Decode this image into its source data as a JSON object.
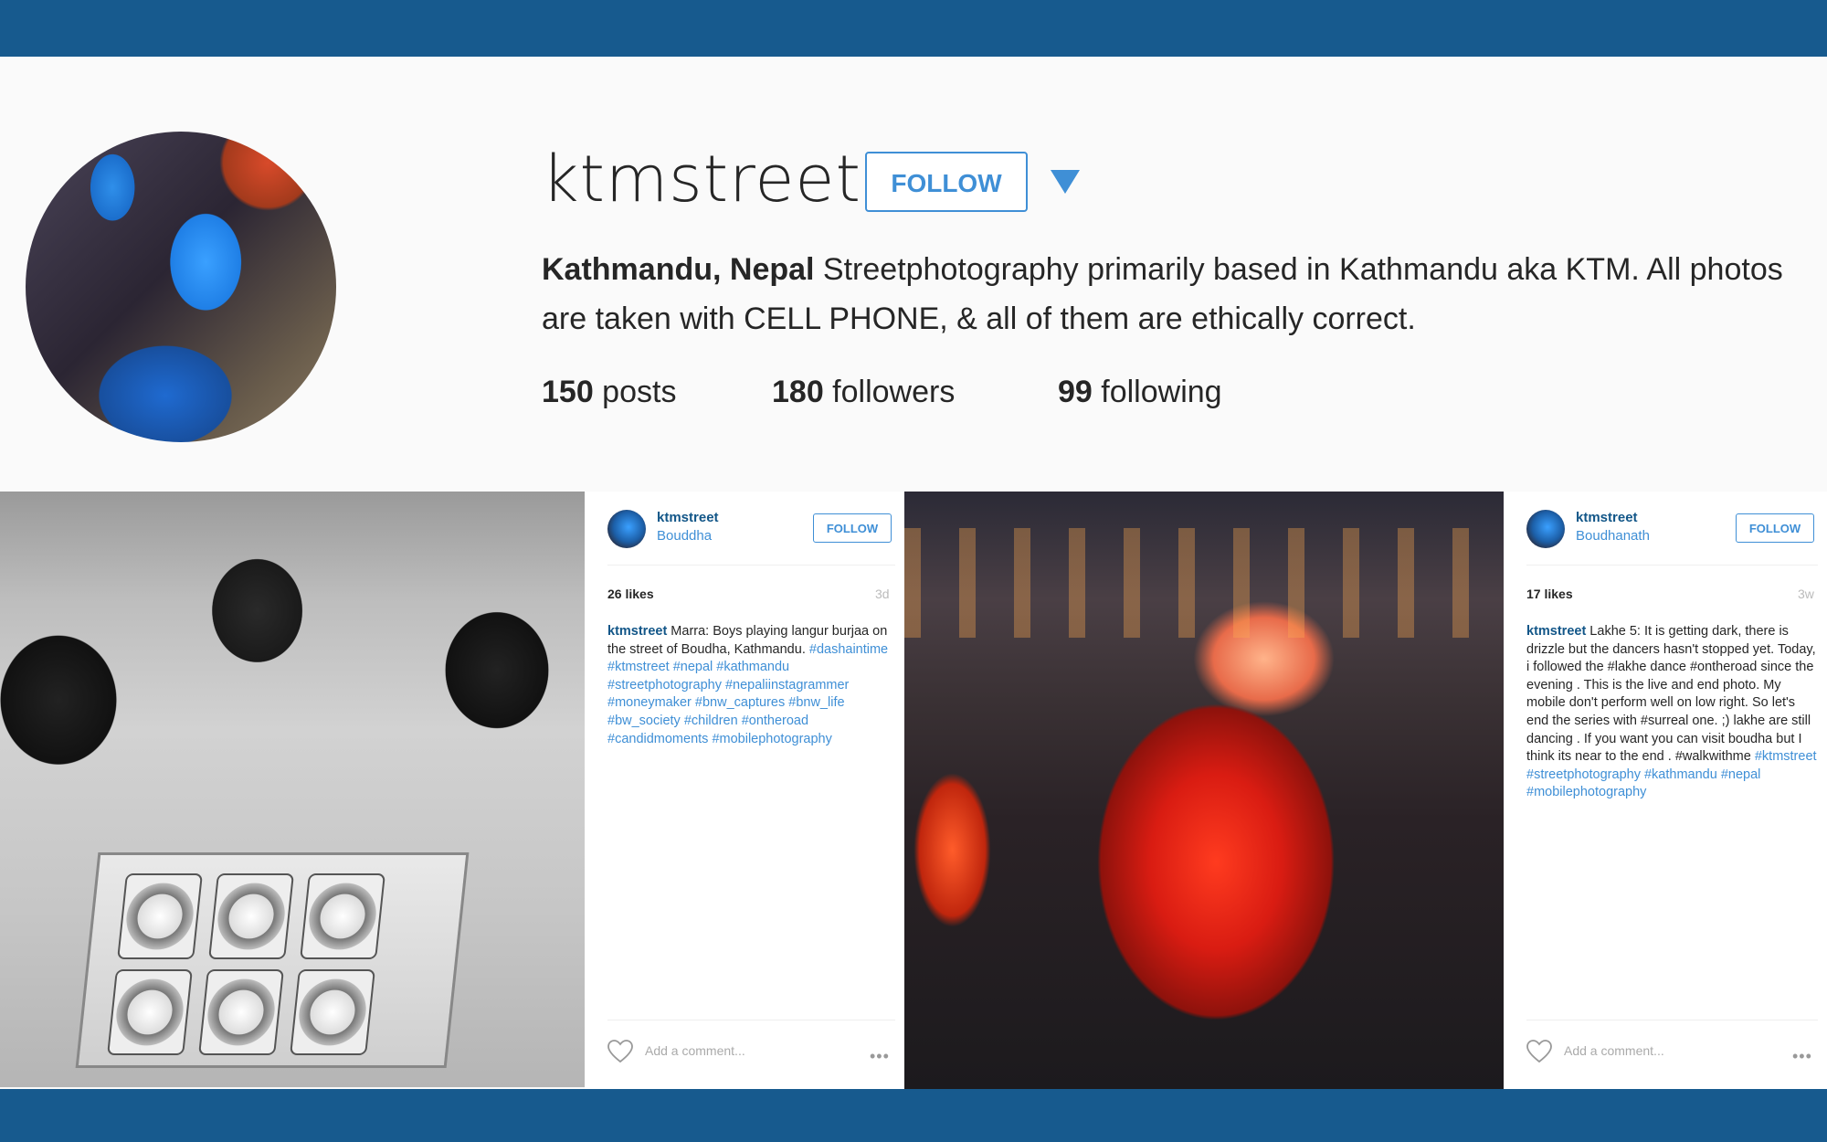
{
  "profile": {
    "username": "ktmstreet",
    "follow_label": "FOLLOW",
    "bio_location": "Kathmandu, Nepal",
    "bio_text": " Streetphotography primarily based in Kathmandu aka KTM. All photos are taken with CELL PHONE, & all of them are ethically correct.",
    "stats": {
      "posts_count": "150",
      "posts_label": " posts",
      "followers_count": "180",
      "followers_label": " followers",
      "following_count": "99",
      "following_label": " following"
    }
  },
  "posts": [
    {
      "username": "ktmstreet",
      "location": "Bouddha",
      "follow_label": "FOLLOW",
      "likes": "26 likes",
      "time": "3d",
      "caption_user": "ktmstreet",
      "caption_text": " Marra: Boys playing langur burjaa on the street of Boudha, Kathmandu.",
      "caption_tags": "#dashaintime #ktmstreet #nepal #kathmandu #streetphotography #nepaliinstagrammer #moneymaker #bnw_captures #bnw_life #bw_society #children #ontheroad #candidmoments #mobilephotography",
      "comment_placeholder": "Add a comment...",
      "more": "•••"
    },
    {
      "username": "ktmstreet",
      "location": "Boudhanath",
      "follow_label": "FOLLOW",
      "likes": "17 likes",
      "time": "3w",
      "caption_user": "ktmstreet",
      "caption_text": " Lakhe 5: It is getting dark, there is drizzle but the dancers hasn't stopped yet. Today, i followed the #lakhe dance #ontheroad since the evening . This is the live and end photo. My mobile don't perform well on low right. So let's end the series with #surreal one. ;) lakhe are still dancing . If you want you can visit boudha but I think its near to the end . #walkwithme",
      "caption_tags": "#ktmstreet #streetphotography #kathmandu #nepal #mobilephotography",
      "comment_placeholder": "Add a comment...",
      "more": "•••"
    }
  ],
  "colors": {
    "frame_bar": "#175a8e",
    "accent": "#3f8fd6",
    "link": "#125688"
  }
}
